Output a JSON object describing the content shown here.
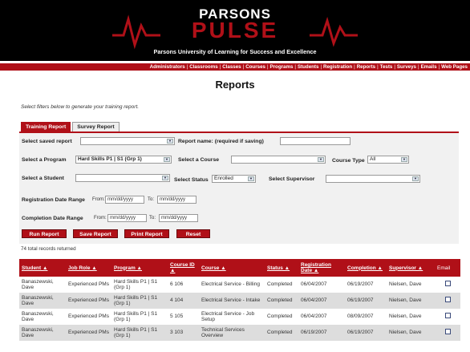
{
  "header": {
    "brand_top": "PARSONS",
    "brand_main": "PULSE",
    "tagline": "Parsons University of Learning for Success and Excellence"
  },
  "nav": [
    "Administrators",
    "Classrooms",
    "Classes",
    "Courses",
    "Programs",
    "Students",
    "Registration",
    "Reports",
    "Tests",
    "Surveys",
    "Emails",
    "Web Pages"
  ],
  "page": {
    "title": "Reports",
    "intro": "Select filters below to generate your training report."
  },
  "tabs": [
    "Training Report",
    "Survey Report"
  ],
  "filters": {
    "saved_report_label": "Select saved report",
    "saved_report_value": "",
    "report_name_label": "Report name: (required if saving)",
    "report_name_value": "",
    "program_label": "Select a Program",
    "program_value": "Hard Skills P1 | S1 (Grp 1)",
    "course_label": "Select a Course",
    "course_value": "",
    "course_type_label": "Course Type",
    "course_type_value": "All",
    "student_label": "Select a Student",
    "student_value": "",
    "status_label": "Select Status",
    "status_value": "Enrolled",
    "supervisor_label": "Select Supervisor",
    "supervisor_value": "",
    "reg_date_label": "Registration Date Range",
    "completion_date_label": "Completion Date Range",
    "from_label": "From:",
    "to_label": "To:",
    "date_placeholder": "mm/dd/yyyy"
  },
  "buttons": {
    "run": "Run Report",
    "save": "Save Report",
    "print": "Print Report",
    "reset": "Reset"
  },
  "results": {
    "count_text": "74 total records returned",
    "columns": [
      "Student ▲",
      "Job Role ▲",
      "Program ▲",
      "Course ID ▲",
      "Course ▲",
      "Status ▲",
      "Registration Date ▲",
      "Completion ▲",
      "Supervisor ▲",
      "Email"
    ],
    "rows": [
      {
        "student": "Banaszewski, Dave",
        "role": "Experienced PMs",
        "program": "Hard Skills P1 | S1 (Grp 1)",
        "course_id": "6 106",
        "course": "Electrical Service - Billing",
        "status": "Completed",
        "reg_date": "06/04/2007",
        "completion": "06/19/2007",
        "supervisor": "Nielsen, Dave"
      },
      {
        "student": "Banaszewski, Dave",
        "role": "Experienced PMs",
        "program": "Hard Skills P1 | S1 (Grp 1)",
        "course_id": "4 104",
        "course": "Electrical Service - Intake",
        "status": "Completed",
        "reg_date": "06/04/2007",
        "completion": "06/19/2007",
        "supervisor": "Nielsen, Dave"
      },
      {
        "student": "Banaszewski, Dave",
        "role": "Experienced PMs",
        "program": "Hard Skills P1 | S1 (Grp 1)",
        "course_id": "5 105",
        "course": "Electrical Service - Job Setup",
        "status": "Completed",
        "reg_date": "06/04/2007",
        "completion": "08/09/2007",
        "supervisor": "Nielsen, Dave"
      },
      {
        "student": "Banaszewski, Dave",
        "role": "Experienced PMs",
        "program": "Hard Skills P1 | S1 (Grp 1)",
        "course_id": "3 103",
        "course": "Technical Services Overview",
        "status": "Completed",
        "reg_date": "06/19/2007",
        "completion": "06/19/2007",
        "supervisor": "Nielsen, Dave"
      }
    ]
  },
  "colors": {
    "accent": "#b01018",
    "header_bg": "#000000",
    "panel_bg": "#f1f1f1"
  }
}
